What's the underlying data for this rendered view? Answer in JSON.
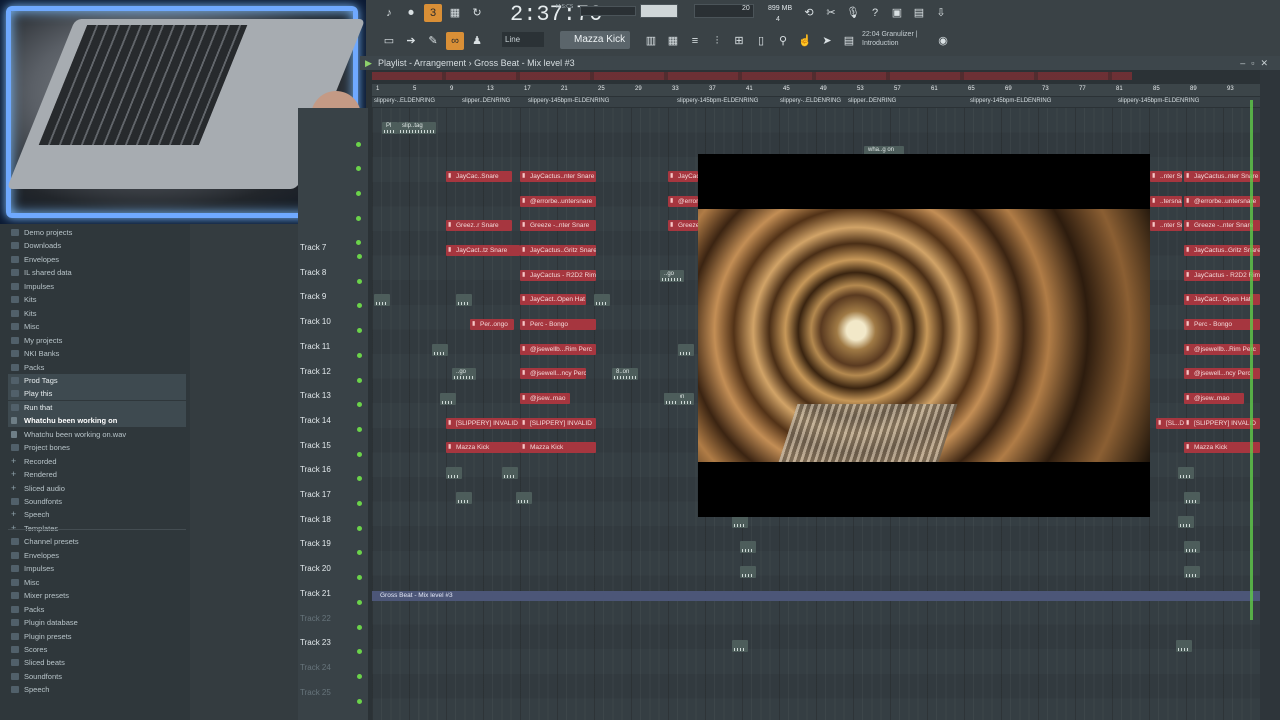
{
  "toolbar": {
    "clock": "2:37:70",
    "clock_unit": "M:S:CS",
    "cpu_value": "20",
    "memory": "899 MB",
    "voices": "4",
    "snap_mode": "Line",
    "pattern": "Mazza Kick",
    "hint_time": "22:04",
    "hint_line1": "Granulizer |",
    "hint_line2": "Introduction"
  },
  "playlist": {
    "title": "Playlist - Arrangement",
    "breadcrumb": "Gross Beat - Mix level #3",
    "ruler_ticks": [
      "1",
      "5",
      "9",
      "13",
      "17",
      "21",
      "25",
      "29",
      "33",
      "37",
      "41",
      "45",
      "49",
      "53",
      "57",
      "61",
      "65",
      "69",
      "73",
      "77",
      "81",
      "85",
      "89",
      "93",
      "97"
    ],
    "markers": [
      "slippery-..ELDENRING",
      "slipper..DENRING",
      "slippery-145bpm-ELDENRING",
      "slippery-145bpm-ELDENRING",
      "slippery-..ELDENRING",
      "slipper..DENRING",
      "slippery-145bpm-ELDENRING",
      "slippery-145bpm-ELDENRING"
    ],
    "automation_label": "Gross Beat - Mix level #3",
    "tracks": [
      {
        "name": "Track 7",
        "dim": false
      },
      {
        "name": "Track 8",
        "dim": false
      },
      {
        "name": "Track 9",
        "dim": false
      },
      {
        "name": "Track 10",
        "dim": false
      },
      {
        "name": "Track 11",
        "dim": false
      },
      {
        "name": "Track 12",
        "dim": false
      },
      {
        "name": "Track 13",
        "dim": false
      },
      {
        "name": "Track 14",
        "dim": false
      },
      {
        "name": "Track 15",
        "dim": false
      },
      {
        "name": "Track 16",
        "dim": false
      },
      {
        "name": "Track 17",
        "dim": false
      },
      {
        "name": "Track 18",
        "dim": false
      },
      {
        "name": "Track 19",
        "dim": false
      },
      {
        "name": "Track 20",
        "dim": false
      },
      {
        "name": "Track 21",
        "dim": false
      },
      {
        "name": "Track 22",
        "dim": true
      },
      {
        "name": "Track 23",
        "dim": false
      },
      {
        "name": "Track 24",
        "dim": true
      },
      {
        "name": "Track 25",
        "dim": true
      }
    ],
    "clips": {
      "snare1": "JayCac..Snare",
      "snare2": "JayCactus..nter Snare",
      "snare3": "JayCact..",
      "snare4": "..nter Snare",
      "snare5": "JayCactus..nter Snare",
      "error1": "@errorbe..untersnare",
      "error2": "@errorr",
      "error3": "..tersnare",
      "error4": "@errorbe..untersnare",
      "greez1": "Greez..r Snare",
      "greez2": "Greeze -..nter Snare",
      "greez3": "Greeze",
      "greez4": "..nter Snare",
      "greez5": "Greeze -..nter Snare",
      "gritz1": "JayCact..tz Snare",
      "gritz2": "JayCactus..Gritz Snare",
      "gritz3": "JayCactus..Gritz Snare",
      "r2d2a": "JayCactus - R2D2 Rim",
      "r2d2b": "JayCactus - R2D2 Rim",
      "hat1": "JayCact..Open Hat",
      "hat2": "JayCact.. Open Hat",
      "perc1": "Per..ongo",
      "perc2": "Perc - Bongo",
      "perc3": "Perc - Bongo",
      "rim1": "@jsewellb...Rim Perc",
      "rim2": "@jsewellb...Rim Perc",
      "ncy1": "@jsewell...ncy Perc",
      "ncy2": "@jsewell...ncy Perc",
      "mao1": "@jsew..mao",
      "mao2": "@jsew..mao",
      "inv1": "[SLIPPERY] INVALID",
      "inv2": "[SLIPPERY] INVALID",
      "inv3": "[SL..D",
      "inv4": "[SLIPPERY] INVALID",
      "kick1": "Mazza Kick",
      "kick2": "Mazza Kick",
      "kick3": "Mazza Kick",
      "slip_tag": "slip..tag",
      "pl": "Pl",
      "wha": "wha..g on",
      "audio_go": "..go",
      "audio_8": "8..on",
      "audio_7": "7..tion"
    }
  },
  "browser": {
    "items": [
      {
        "label": "Demo projects",
        "icon": "folder",
        "cls": ""
      },
      {
        "label": "Downloads",
        "icon": "folder",
        "cls": ""
      },
      {
        "label": "Envelopes",
        "icon": "folder",
        "cls": ""
      },
      {
        "label": "IL shared data",
        "icon": "folder",
        "cls": ""
      },
      {
        "label": "Impulses",
        "icon": "folder",
        "cls": ""
      },
      {
        "label": "Kits",
        "icon": "folder",
        "cls": ""
      },
      {
        "label": "Kits",
        "icon": "folder",
        "cls": ""
      },
      {
        "label": "Misc",
        "icon": "folder",
        "cls": ""
      },
      {
        "label": "My projects",
        "icon": "folder",
        "cls": ""
      },
      {
        "label": "NKI Banks",
        "icon": "folder",
        "cls": ""
      },
      {
        "label": "Packs",
        "icon": "folder",
        "cls": ""
      },
      {
        "label": "Prod Tags",
        "icon": "folder",
        "cls": "selected"
      },
      {
        "label": "Play this",
        "icon": "folder",
        "cls": "selected"
      },
      {
        "label": "Run that",
        "icon": "folder",
        "cls": "selected"
      },
      {
        "label": "Whatchu been working on",
        "icon": "doc",
        "cls": "selected bold"
      },
      {
        "label": "Whatchu been working on.wav",
        "icon": "doc",
        "cls": ""
      },
      {
        "label": "Project bones",
        "icon": "folder",
        "cls": ""
      },
      {
        "label": "Recorded",
        "icon": "plus",
        "cls": ""
      },
      {
        "label": "Rendered",
        "icon": "plus",
        "cls": ""
      },
      {
        "label": "Sliced audio",
        "icon": "plus",
        "cls": ""
      },
      {
        "label": "Soundfonts",
        "icon": "folder",
        "cls": ""
      },
      {
        "label": "Speech",
        "icon": "plus",
        "cls": ""
      },
      {
        "label": "Templates",
        "icon": "plus",
        "cls": ""
      },
      {
        "label": "Channel presets",
        "icon": "folder",
        "cls": ""
      },
      {
        "label": "Envelopes",
        "icon": "folder",
        "cls": ""
      },
      {
        "label": "Impulses",
        "icon": "folder",
        "cls": ""
      },
      {
        "label": "Misc",
        "icon": "folder",
        "cls": ""
      },
      {
        "label": "Mixer presets",
        "icon": "folder",
        "cls": ""
      },
      {
        "label": "Packs",
        "icon": "folder",
        "cls": ""
      },
      {
        "label": "Plugin database",
        "icon": "folder",
        "cls": ""
      },
      {
        "label": "Plugin presets",
        "icon": "folder",
        "cls": ""
      },
      {
        "label": "Scores",
        "icon": "folder",
        "cls": ""
      },
      {
        "label": "Sliced beats",
        "icon": "folder",
        "cls": ""
      },
      {
        "label": "Soundfonts",
        "icon": "folder",
        "cls": ""
      },
      {
        "label": "Speech",
        "icon": "folder",
        "cls": ""
      }
    ]
  }
}
